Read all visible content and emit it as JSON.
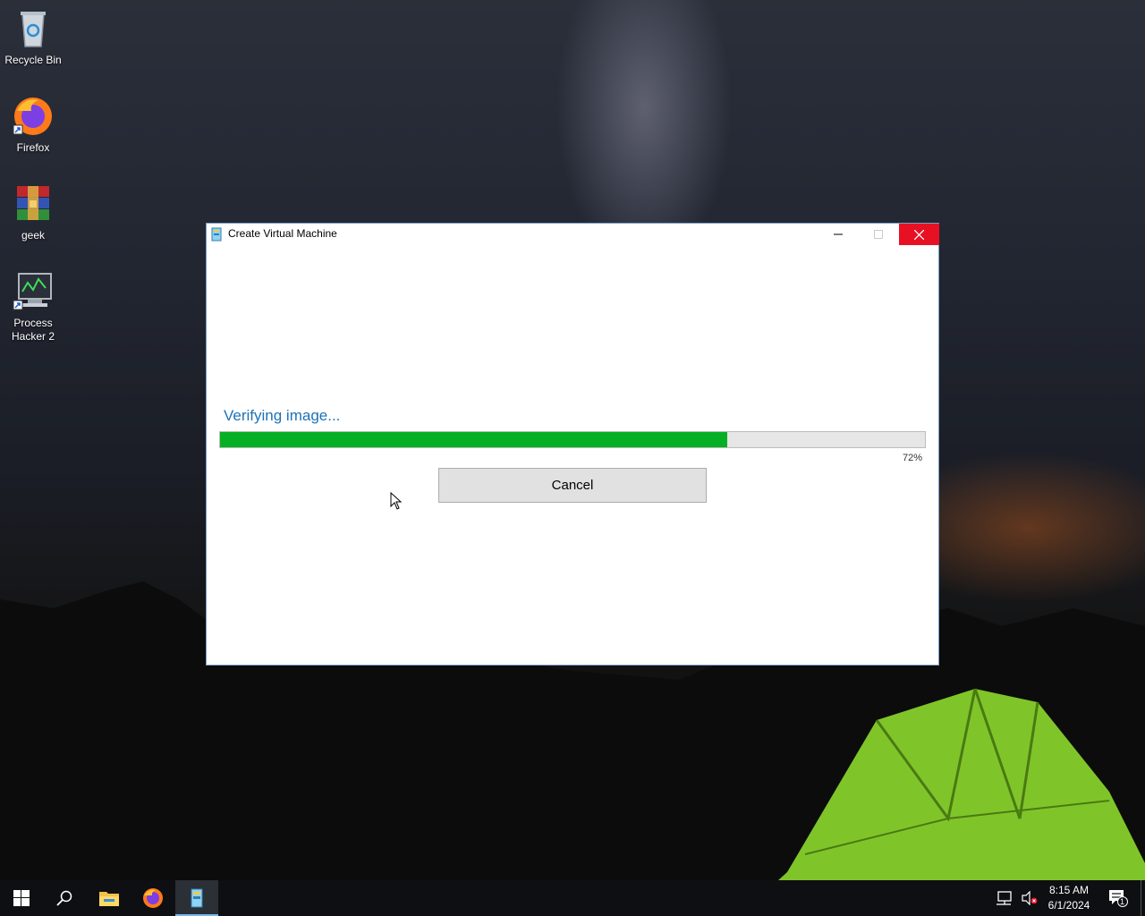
{
  "desktop": {
    "icons": [
      {
        "label": "Recycle Bin",
        "icon": "recycle-bin-icon"
      },
      {
        "label": "Firefox",
        "icon": "firefox-icon"
      },
      {
        "label": "geek",
        "icon": "winrar-icon"
      },
      {
        "label": "Process Hacker 2",
        "icon": "process-hacker-icon"
      }
    ]
  },
  "window": {
    "title": "Create Virtual Machine",
    "icon": "virtual-machine-icon",
    "controls": {
      "minimize": "minimize-icon",
      "maximize": "maximize-icon",
      "close": "close-icon"
    },
    "status_text": "Verifying image...",
    "progress": {
      "value": 72,
      "label": "72%",
      "color": "#06b025"
    },
    "cancel_label": "Cancel"
  },
  "taskbar": {
    "items": [
      "start-icon",
      "search-icon",
      "file-explorer-icon",
      "firefox-icon",
      "virtual-machine-icon"
    ],
    "tray": [
      "network-icon",
      "volume-muted-icon"
    ],
    "time": "8:15 AM",
    "date": "6/1/2024",
    "notifications": "1"
  }
}
